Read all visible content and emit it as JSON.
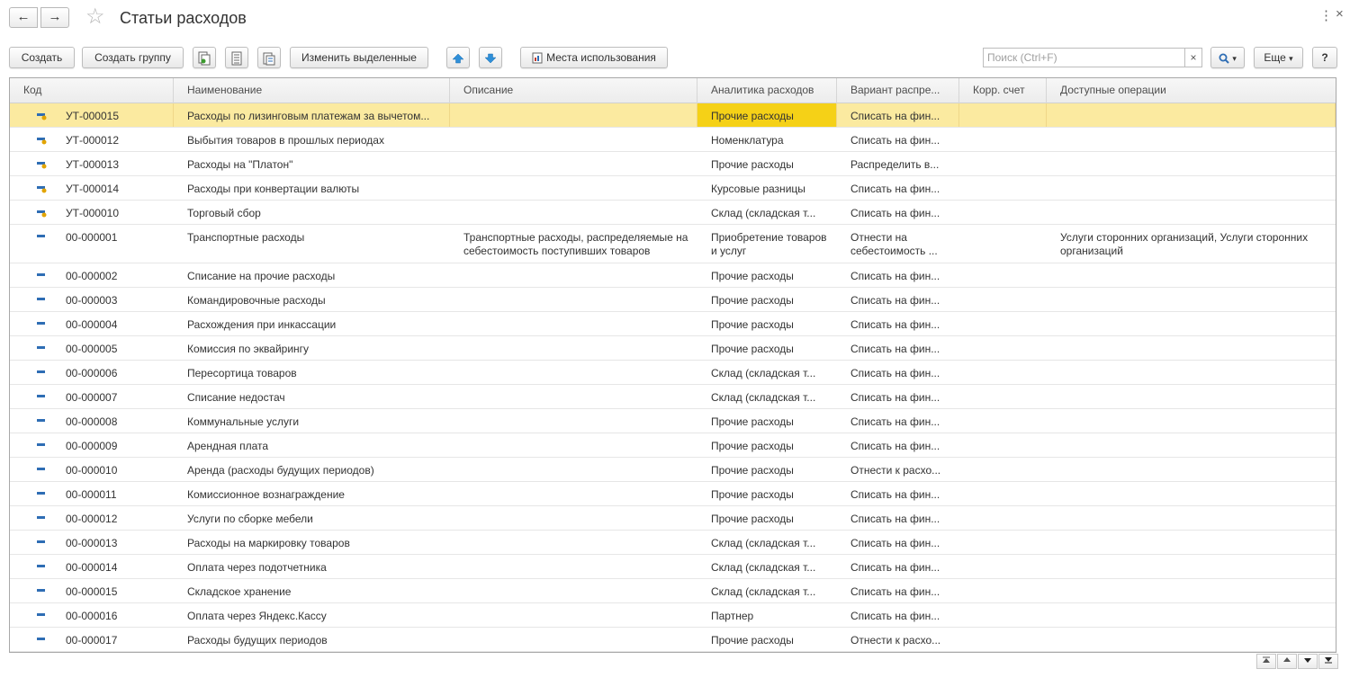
{
  "window": {
    "title": "Статьи расходов",
    "back_glyph": "←",
    "forward_glyph": "→",
    "favorite_glyph": "☆",
    "menu_glyph": "⋮",
    "close_glyph": "×"
  },
  "toolbar": {
    "create": "Создать",
    "create_group": "Создать группу",
    "icon_copy": "copy-icon",
    "icon_list": "list-icon",
    "icon_paste": "paste-icon",
    "change_selected": "Изменить выделенные",
    "icon_up": "arrow-up-icon",
    "icon_down": "arrow-down-icon",
    "usage_places": "Места использования",
    "search_placeholder": "Поиск (Ctrl+F)",
    "search_clear": "×",
    "search_icon": "search-icon",
    "dropdown_glyph": "▾",
    "more": "Еще",
    "help": "?"
  },
  "colors": {
    "selected_row": "#fbeaa0",
    "selected_cell": "#f5d117",
    "arrow_blue": "#2f8fd8",
    "marker_item": "#2e6db4",
    "marker_new": "#e2a400"
  },
  "table": {
    "headers": [
      "Код",
      "Наименование",
      "Описание",
      "Аналитика расходов",
      "Вариант распре...",
      "Корр. счет",
      "Доступные операции"
    ],
    "rows": [
      {
        "marker": "marked-item-icon",
        "code": "УТ-000015",
        "name": "Расходы по лизинговым платежам за вычетом...",
        "description": "",
        "analytics": "Прочие расходы",
        "variant": "Списать на фин...",
        "account": "",
        "operations": "",
        "selected": true
      },
      {
        "marker": "marked-item-icon",
        "code": "УТ-000012",
        "name": "Выбытия товаров в прошлых периодах",
        "description": "",
        "analytics": "Номенклатура",
        "variant": "Списать на фин...",
        "account": "",
        "operations": ""
      },
      {
        "marker": "marked-item-icon",
        "code": "УТ-000013",
        "name": "Расходы на \"Платон\"",
        "description": "",
        "analytics": "Прочие расходы",
        "variant": "Распределить в...",
        "account": "",
        "operations": ""
      },
      {
        "marker": "marked-item-icon",
        "code": "УТ-000014",
        "name": "Расходы при конвертации валюты",
        "description": "",
        "analytics": "Курсовые разницы",
        "variant": "Списать на фин...",
        "account": "",
        "operations": ""
      },
      {
        "marker": "marked-item-icon",
        "code": "УТ-000010",
        "name": "Торговый сбор",
        "description": "",
        "analytics": "Склад (складская т...",
        "variant": "Списать на фин...",
        "account": "",
        "operations": ""
      },
      {
        "marker": "item-icon",
        "code": "00-000001",
        "name": "Транспортные расходы",
        "description": "Транспортные расходы, распределяемые на себестоимость поступивших товаров",
        "analytics": "Приобретение товаров и услуг",
        "variant": "Отнести на себестоимость ...",
        "account": "",
        "operations": "Услуги сторонних организаций, Услуги сторонних организаций",
        "tall": true
      },
      {
        "marker": "item-icon",
        "code": "00-000002",
        "name": "Списание на прочие расходы",
        "description": "",
        "analytics": "Прочие расходы",
        "variant": "Списать на фин...",
        "account": "",
        "operations": ""
      },
      {
        "marker": "item-icon",
        "code": "00-000003",
        "name": "Командировочные расходы",
        "description": "",
        "analytics": "Прочие расходы",
        "variant": "Списать на фин...",
        "account": "",
        "operations": ""
      },
      {
        "marker": "item-icon",
        "code": "00-000004",
        "name": "Расхождения при инкассации",
        "description": "",
        "analytics": "Прочие расходы",
        "variant": "Списать на фин...",
        "account": "",
        "operations": ""
      },
      {
        "marker": "item-icon",
        "code": "00-000005",
        "name": "Комиссия по эквайрингу",
        "description": "",
        "analytics": "Прочие расходы",
        "variant": "Списать на фин...",
        "account": "",
        "operations": ""
      },
      {
        "marker": "item-icon",
        "code": "00-000006",
        "name": "Пересортица товаров",
        "description": "",
        "analytics": "Склад (складская т...",
        "variant": "Списать на фин...",
        "account": "",
        "operations": ""
      },
      {
        "marker": "item-icon",
        "code": "00-000007",
        "name": "Списание недостач",
        "description": "",
        "analytics": "Склад (складская т...",
        "variant": "Списать на фин...",
        "account": "",
        "operations": ""
      },
      {
        "marker": "item-icon",
        "code": "00-000008",
        "name": "Коммунальные услуги",
        "description": "",
        "analytics": "Прочие расходы",
        "variant": "Списать на фин...",
        "account": "",
        "operations": ""
      },
      {
        "marker": "item-icon",
        "code": "00-000009",
        "name": "Арендная плата",
        "description": "",
        "analytics": "Прочие расходы",
        "variant": "Списать на фин...",
        "account": "",
        "operations": ""
      },
      {
        "marker": "item-icon",
        "code": "00-000010",
        "name": "Аренда (расходы будущих периодов)",
        "description": "",
        "analytics": "Прочие расходы",
        "variant": "Отнести к расхо...",
        "account": "",
        "operations": ""
      },
      {
        "marker": "item-icon",
        "code": "00-000011",
        "name": "Комиссионное вознаграждение",
        "description": "",
        "analytics": "Прочие расходы",
        "variant": "Списать на фин...",
        "account": "",
        "operations": ""
      },
      {
        "marker": "item-icon",
        "code": "00-000012",
        "name": "Услуги по сборке мебели",
        "description": "",
        "analytics": "Прочие расходы",
        "variant": "Списать на фин...",
        "account": "",
        "operations": ""
      },
      {
        "marker": "item-icon",
        "code": "00-000013",
        "name": "Расходы на маркировку товаров",
        "description": "",
        "analytics": "Склад (складская т...",
        "variant": "Списать на фин...",
        "account": "",
        "operations": ""
      },
      {
        "marker": "item-icon",
        "code": "00-000014",
        "name": "Оплата через подотчетника",
        "description": "",
        "analytics": "Склад (складская т...",
        "variant": "Списать на фин...",
        "account": "",
        "operations": ""
      },
      {
        "marker": "item-icon",
        "code": "00-000015",
        "name": "Складское хранение",
        "description": "",
        "analytics": "Склад (складская т...",
        "variant": "Списать на фин...",
        "account": "",
        "operations": ""
      },
      {
        "marker": "item-icon",
        "code": "00-000016",
        "name": "Оплата через Яндекс.Кассу",
        "description": "",
        "analytics": "Партнер",
        "variant": "Списать на фин...",
        "account": "",
        "operations": ""
      },
      {
        "marker": "item-icon",
        "code": "00-000017",
        "name": "Расходы будущих периодов",
        "description": "",
        "analytics": "Прочие расходы",
        "variant": "Отнести к расхо...",
        "account": "",
        "operations": ""
      }
    ]
  },
  "pager": {
    "first": "go-first-icon",
    "prev": "go-up-icon",
    "next": "go-down-icon",
    "last": "go-last-icon"
  }
}
